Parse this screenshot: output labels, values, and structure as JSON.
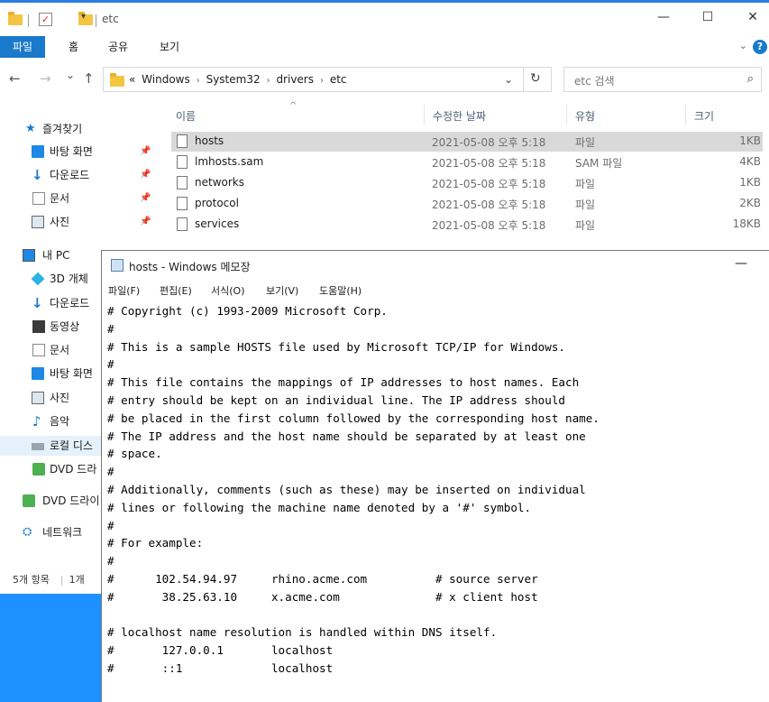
{
  "explorer": {
    "title": "etc",
    "window_controls": {
      "minimize": "—",
      "maximize": "☐",
      "close": "✕"
    },
    "ribbon_tabs": [
      "파일",
      "홈",
      "공유",
      "보기"
    ],
    "help": "?",
    "nav": {
      "back": "←",
      "forward": "→",
      "recent": "⌄",
      "up": "↑"
    },
    "breadcrumb": {
      "overflow": "«",
      "items": [
        "Windows",
        "System32",
        "drivers",
        "etc"
      ]
    },
    "search_placeholder": "etc 검색",
    "columns": {
      "name": "이름",
      "date": "수정한 날짜",
      "type": "유형",
      "size": "크기"
    },
    "files": [
      {
        "name": "hosts",
        "date": "2021-05-08 오후 5:18",
        "type": "파일",
        "size": "1KB",
        "selected": true
      },
      {
        "name": "lmhosts.sam",
        "date": "2021-05-08 오후 5:18",
        "type": "SAM 파일",
        "size": "4KB",
        "selected": false
      },
      {
        "name": "networks",
        "date": "2021-05-08 오후 5:18",
        "type": "파일",
        "size": "1KB",
        "selected": false
      },
      {
        "name": "protocol",
        "date": "2021-05-08 오후 5:18",
        "type": "파일",
        "size": "2KB",
        "selected": false
      },
      {
        "name": "services",
        "date": "2021-05-08 오후 5:18",
        "type": "파일",
        "size": "18KB",
        "selected": false
      }
    ],
    "sidebar": {
      "quick_access": "즐겨찾기",
      "quick_items": [
        "바탕 화면",
        "다운로드",
        "문서",
        "사진"
      ],
      "this_pc": "내 PC",
      "pc_items": [
        "3D 개체",
        "다운로드",
        "동영상",
        "문서",
        "바탕 화면",
        "사진",
        "음악",
        "로컬 디스",
        "DVD 드라"
      ],
      "dvd_drive": "DVD 드라이",
      "network": "네트워크"
    },
    "status": {
      "count": "5개 항목",
      "selected": "1개"
    }
  },
  "notepad": {
    "title": "hosts - Windows 메모장",
    "minimize": "—",
    "menu": [
      "파일(F)",
      "편집(E)",
      "서식(O)",
      "보기(V)",
      "도움말(H)"
    ],
    "content": "# Copyright (c) 1993-2009 Microsoft Corp.\n#\n# This is a sample HOSTS file used by Microsoft TCP/IP for Windows.\n#\n# This file contains the mappings of IP addresses to host names. Each\n# entry should be kept on an individual line. The IP address should\n# be placed in the first column followed by the corresponding host name.\n# The IP address and the host name should be separated by at least one\n# space.\n#\n# Additionally, comments (such as these) may be inserted on individual\n# lines or following the machine name denoted by a '#' symbol.\n#\n# For example:\n#\n#      102.54.94.97     rhino.acme.com          # source server\n#       38.25.63.10     x.acme.com              # x client host\n\n# localhost name resolution is handled within DNS itself.\n#       127.0.0.1       localhost\n#       ::1             localhost"
  }
}
